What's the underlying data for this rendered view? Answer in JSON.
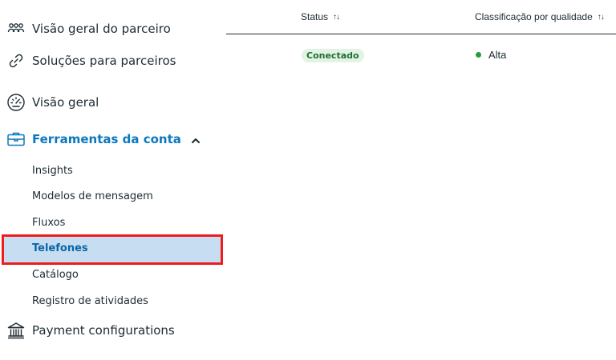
{
  "sidebar": {
    "top_items": [
      {
        "label": "Visão geral do parceiro",
        "icon": "partners-icon"
      },
      {
        "label": "Soluções para parceiros",
        "icon": "link-icon"
      },
      {
        "label": "Visão geral",
        "icon": "dashboard-gauge-icon"
      }
    ],
    "group": {
      "label": "Ferramentas da conta",
      "icon": "briefcase-icon",
      "expanded": true
    },
    "sub_items": [
      {
        "label": "Insights"
      },
      {
        "label": "Modelos de mensagem"
      },
      {
        "label": "Fluxos"
      },
      {
        "label": "Telefones",
        "selected": true
      },
      {
        "label": "Catálogo"
      },
      {
        "label": "Registro de atividades"
      }
    ],
    "bottom_item": {
      "label": "Payment configurations",
      "icon": "bank-icon"
    }
  },
  "table": {
    "columns": [
      {
        "label": "Status",
        "sort_icon": "sort-arrows-icon"
      },
      {
        "label": "Classificação por qualidade",
        "sort_icon": "sort-arrows-icon"
      }
    ],
    "rows": [
      {
        "status": "Conectado",
        "quality": "Alta"
      }
    ]
  },
  "colors": {
    "accent": "#0a78be",
    "selected_bg": "#c7def2",
    "highlight_border": "#ee1c1c",
    "badge_bg": "#e3f3e3",
    "badge_text": "#1f6e36",
    "quality_dot": "#23a03c"
  }
}
